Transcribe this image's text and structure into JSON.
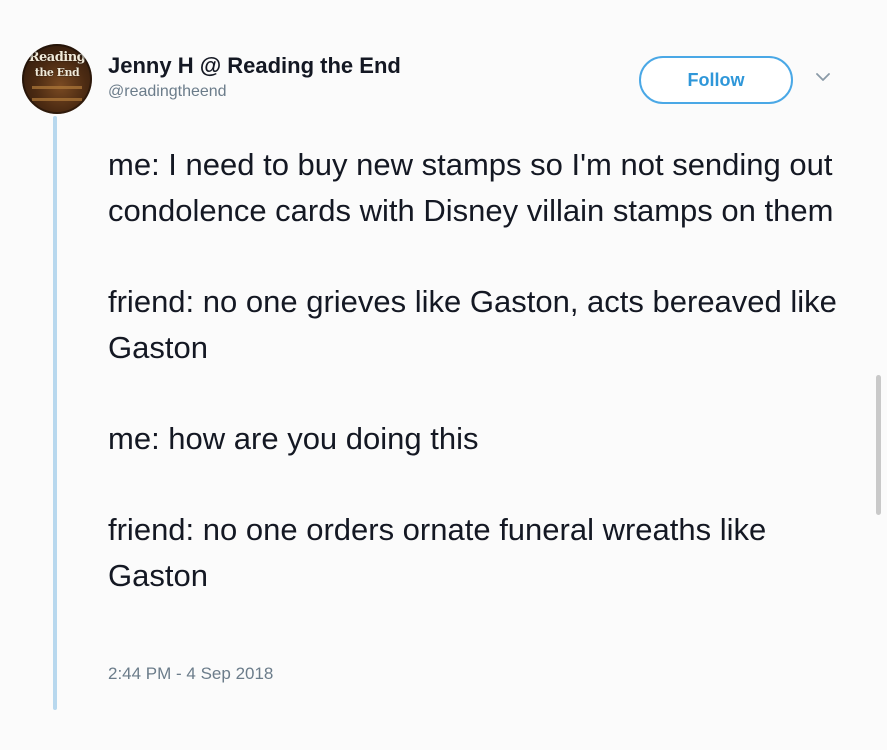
{
  "tweet": {
    "author": {
      "display_name": "Jenny H @ Reading the End",
      "handle": "@readingtheend",
      "avatar_text_line1": "Reading",
      "avatar_text_line2": "the End"
    },
    "follow_label": "Follow",
    "paragraphs": [
      "me: I need to buy new stamps so I'm not sending out condolence cards with Disney villain stamps on them",
      "friend: no one grieves like Gaston, acts bereaved like Gaston",
      "me: how are you doing this",
      "friend: no one orders ornate funeral wreaths like Gaston"
    ],
    "timestamp": "2:44 PM - 4 Sep 2018"
  },
  "icons": {
    "menu": "chevron-down-icon"
  },
  "colors": {
    "accent": "#2f97d9",
    "thread_line": "#b8d8ee",
    "text": "#141823",
    "muted": "#6b7c8a"
  }
}
